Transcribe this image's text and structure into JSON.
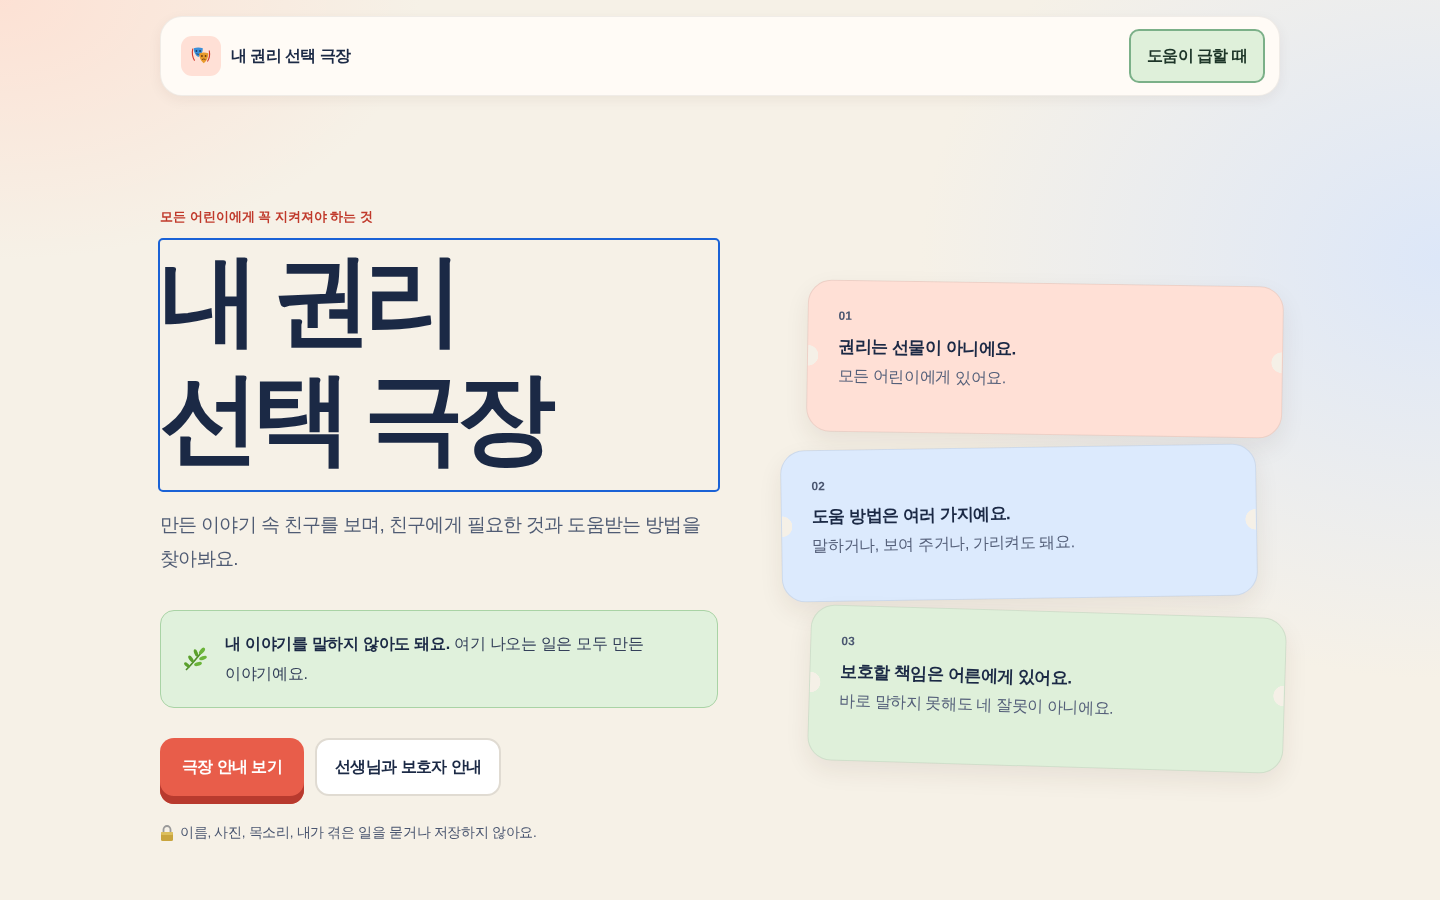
{
  "header": {
    "title": "내 권리 선택 극장",
    "help_button": "도움이 급할 때"
  },
  "hero": {
    "eyebrow": "모든 어린이에게 꼭 지켜져야 하는 것",
    "title": {
      "lines": [
        "내 권리",
        "선택 극장"
      ],
      "focused": true
    },
    "subtitle": "만든 이야기 속 친구를 보며, 친구에게 필요한 것과 도움받는 방법을 찾아봐요.",
    "note": "**내 이야기를 말하지 않아도 돼요.** 여기 나오는 일은 모두 만든 이야기예요.",
    "buttons": [
      {
        "label": "극장 안내 보기",
        "kind": "primary"
      },
      {
        "label": "선생님과 보호자 안내",
        "kind": "secondary"
      }
    ],
    "privacy": "이름, 사진, 목소리, 내가 겪은 일을 묻거나 저장하지 않아요."
  },
  "cards": [
    {
      "number": "01",
      "title": "권리는 선물이 아니에요.",
      "text": "모든 어린이에게 있어요.",
      "color": "#ffe0d6"
    },
    {
      "number": "02",
      "title": "도움 방법은 여러 가지예요.",
      "text": "말하거나, 보여 주거나, 가리켜도 돼요.",
      "color": "#dceafd"
    },
    {
      "number": "03",
      "title": "보호할 책임은 어른에게 있어요.",
      "text": "바로 말하지 못해도 네 잘못이 아니에요.",
      "color": "#dff0da"
    }
  ]
}
